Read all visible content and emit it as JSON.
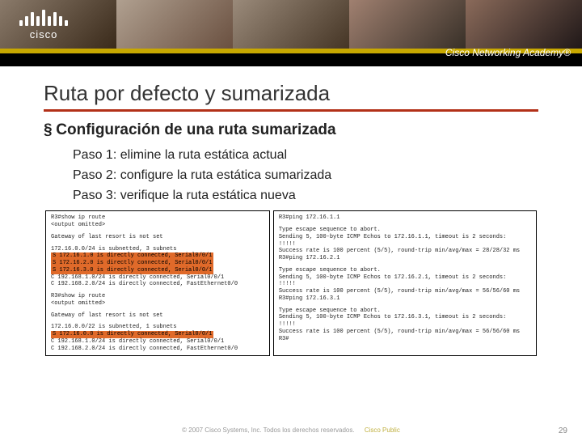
{
  "brand": {
    "name": "cisco",
    "program": "Cisco Networking Academy®"
  },
  "title": "Ruta por defecto y sumarizada",
  "section": {
    "bullet": "§",
    "text": "Configuración de una ruta sumarizada"
  },
  "steps": [
    "Paso 1: elimine la ruta estática actual",
    "Paso 2: configure la ruta estática sumarizada",
    "Paso 3: verifique la ruta estática nueva"
  ],
  "cli": {
    "left": {
      "block1": {
        "cmd": "R3#show ip route",
        "omit": "<output omitted>",
        "gw": "Gateway of last resort is not set",
        "hdr": "     172.16.0.0/24 is subnetted, 3 subnets",
        "s1": "S       172.16.1.0 is directly connected, Serial0/0/1",
        "s2": "S       172.16.2.0 is directly connected, Serial0/0/1",
        "s3": "S       172.16.3.0 is directly connected, Serial0/0/1",
        "c1": "C    192.168.1.0/24 is directly connected, Serial0/0/1",
        "c2": "C    192.168.2.0/24 is directly connected, FastEthernet0/0"
      },
      "block2": {
        "cmd": "R3#show ip route",
        "omit": "<output omitted>",
        "gw": "Gateway of last resort is not set",
        "hdr": "     172.16.0.0/22 is subnetted, 1 subnets",
        "s1": "S       172.16.0.0 is directly connected, Serial0/0/1",
        "c1": "C    192.168.1.0/24 is directly connected, Serial0/0/1",
        "c2": "C    192.168.2.0/24 is directly connected, FastEthernet0/0"
      }
    },
    "right": {
      "p1": {
        "cmd": "R3#ping 172.16.1.1",
        "l1": "Type escape sequence to abort.",
        "l2": "Sending 5, 100-byte ICMP Echos to 172.16.1.1, timeout is 2 seconds:",
        "l3": "!!!!!",
        "l4": "Success rate is 100 percent (5/5), round-trip min/avg/max = 28/28/32 ms"
      },
      "p2": {
        "cmd": "R3#ping 172.16.2.1",
        "l1": "Type escape sequence to abort.",
        "l2": "Sending 5, 100-byte ICMP Echos to 172.16.2.1, timeout is 2 seconds:",
        "l3": "!!!!!",
        "l4": "Success rate is 100 percent (5/5), round-trip min/avg/max = 56/56/60 ms"
      },
      "p3": {
        "cmd": "R3#ping 172.16.3.1",
        "l1": "Type escape sequence to abort.",
        "l2": "Sending 5, 100-byte ICMP Echos to 172.16.3.1, timeout is 2 seconds:",
        "l3": "!!!!!",
        "l4": "Success rate is 100 percent (5/5), round-trip min/avg/max = 56/56/60 ms",
        "l5": "R3#"
      }
    }
  },
  "footer": {
    "copyright": "© 2007 Cisco Systems, Inc. Todos los derechos reservados.",
    "classification": "Cisco Public",
    "page": "29"
  }
}
